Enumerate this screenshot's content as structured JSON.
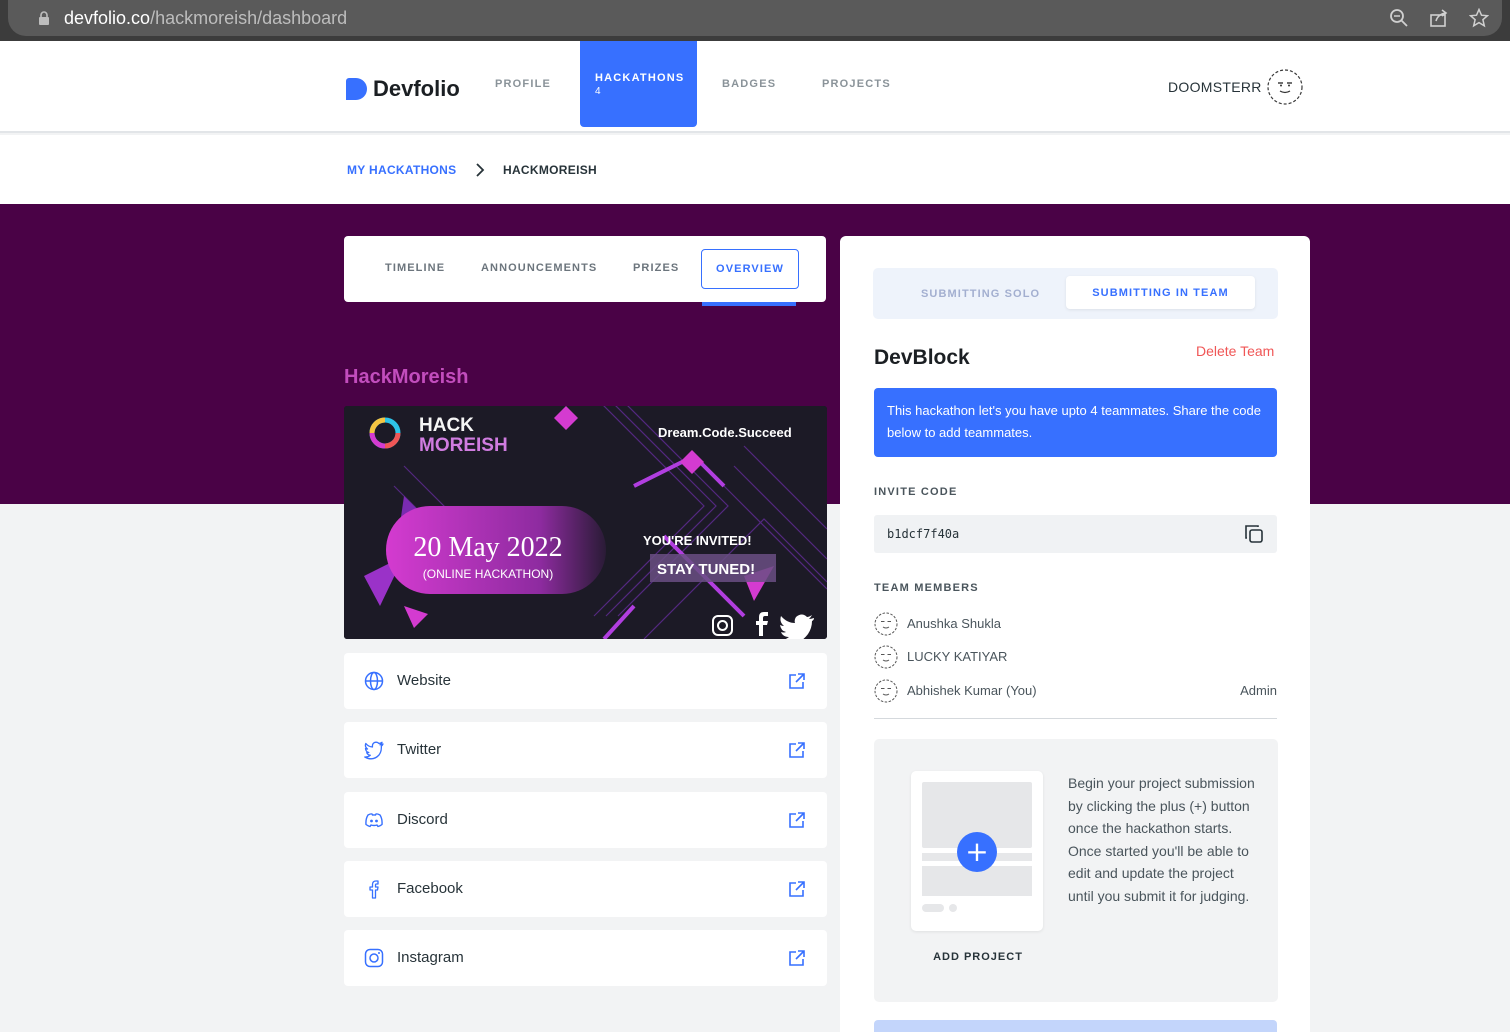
{
  "browser": {
    "url_host": "devfolio.co",
    "url_path": "/hackmoreish/dashboard"
  },
  "nav": {
    "logo_text": "Devfolio",
    "items": [
      {
        "label": "PROFILE"
      },
      {
        "label": "HACKATHONS",
        "count": "4"
      },
      {
        "label": "BADGES"
      },
      {
        "label": "PROJECTS"
      }
    ],
    "username": "DOOMSTERR"
  },
  "breadcrumb": {
    "parent": "MY HACKATHONS",
    "current": "HACKMOREISH"
  },
  "tabs": [
    "TIMELINE",
    "ANNOUNCEMENTS",
    "PRIZES",
    "OVERVIEW"
  ],
  "hackathon": {
    "title": "HackMoreish",
    "banner": {
      "brand_line1": "HACK",
      "brand_line2": "MOREISH",
      "tagline": "Dream.Code.Succeed",
      "date": "20 May 2022",
      "mode": "(ONLINE HACKATHON)",
      "invited": "YOU'RE INVITED!",
      "stay_tuned": "STAY TUNED!"
    },
    "links": [
      {
        "label": "Website",
        "icon": "globe-icon"
      },
      {
        "label": "Twitter",
        "icon": "twitter-icon"
      },
      {
        "label": "Discord",
        "icon": "discord-icon"
      },
      {
        "label": "Facebook",
        "icon": "facebook-icon"
      },
      {
        "label": "Instagram",
        "icon": "instagram-icon"
      }
    ]
  },
  "team_panel": {
    "toggle_solo": "SUBMITTING SOLO",
    "toggle_team": "SUBMITTING IN TEAM",
    "team_name": "DevBlock",
    "delete_label": "Delete Team",
    "info": "This hackathon let's you have upto 4 teammates. Share the code below to add teammates.",
    "invite_label": "INVITE CODE",
    "invite_code": "b1dcf7f40a",
    "members_label": "TEAM MEMBERS",
    "members": [
      {
        "name": "Anushka Shukla",
        "role": ""
      },
      {
        "name": "LUCKY KATIYAR",
        "role": ""
      },
      {
        "name": "Abhishek Kumar (You)",
        "role": "Admin"
      }
    ],
    "add_project_label": "ADD PROJECT",
    "add_project_desc": "Begin your project submission by clicking the plus (+) button once the hackathon starts. Once started you'll be able to edit and update the project until you submit it for judging."
  },
  "colors": {
    "accent": "#3770ff",
    "purple_band": "#4a0246",
    "title_pink": "#c24dbd",
    "danger": "#f05656"
  }
}
